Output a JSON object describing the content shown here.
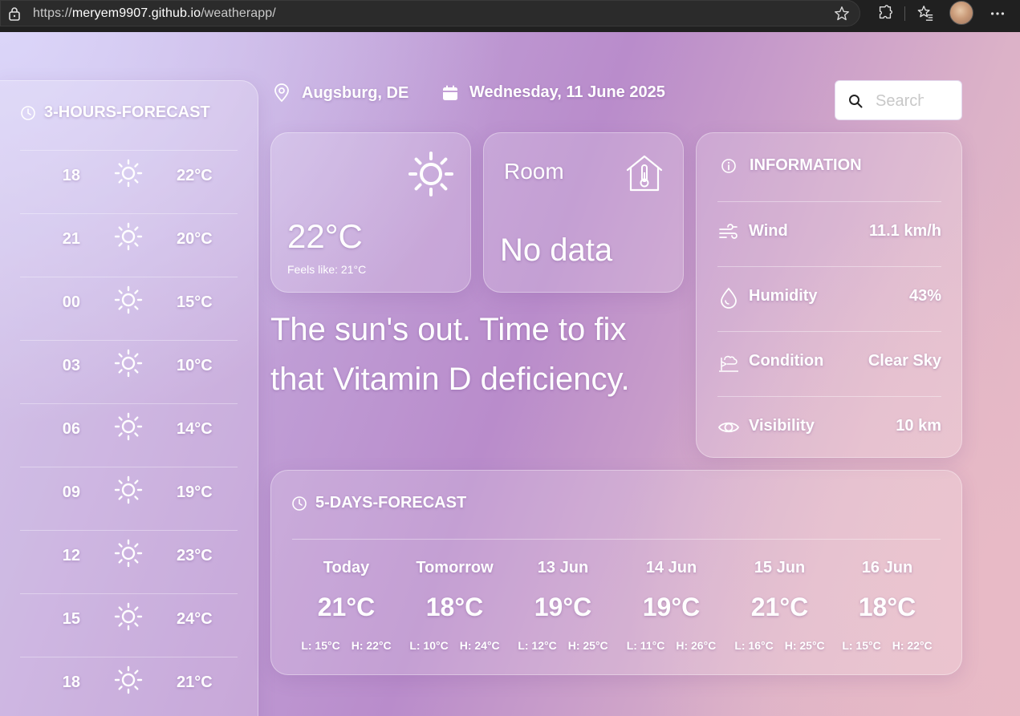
{
  "browser": {
    "url_prefix": "https://",
    "url_host": "meryem9907.github.io",
    "url_path": "/weatherapp/"
  },
  "header": {
    "location": "Augsburg, DE",
    "date": "Wednesday, 11 June 2025",
    "search_placeholder": "Search"
  },
  "hourly": {
    "title": "3-HOURS-FORECAST",
    "rows": [
      {
        "hour": "18",
        "temp": "22°C",
        "icon": "sun-icon"
      },
      {
        "hour": "21",
        "temp": "20°C",
        "icon": "sun-icon"
      },
      {
        "hour": "00",
        "temp": "15°C",
        "icon": "sun-icon"
      },
      {
        "hour": "03",
        "temp": "10°C",
        "icon": "sun-icon"
      },
      {
        "hour": "06",
        "temp": "14°C",
        "icon": "sun-icon"
      },
      {
        "hour": "09",
        "temp": "19°C",
        "icon": "sun-icon"
      },
      {
        "hour": "12",
        "temp": "23°C",
        "icon": "sun-icon"
      },
      {
        "hour": "15",
        "temp": "24°C",
        "icon": "sun-icon"
      },
      {
        "hour": "18",
        "temp": "21°C",
        "icon": "sun-icon"
      }
    ]
  },
  "current": {
    "temp": "22°C",
    "feels_like": "Feels like: 21°C",
    "icon": "sun-icon"
  },
  "room": {
    "title": "Room",
    "value": "No data",
    "icon": "house-thermometer-icon"
  },
  "quote": "The sun's out. Time to fix that Vitamin D deficiency.",
  "information": {
    "title": "INFORMATION",
    "rows": [
      {
        "label": "Wind",
        "value": "11.1 km/h",
        "icon": "wind-icon"
      },
      {
        "label": "Humidity",
        "value": "43%",
        "icon": "droplet-icon"
      },
      {
        "label": "Condition",
        "value": "Clear Sky",
        "icon": "weather-vane-icon"
      },
      {
        "label": "Visibility",
        "value": "10 km",
        "icon": "eye-icon"
      }
    ]
  },
  "five_day": {
    "title": "5-DAYS-FORECAST",
    "days": [
      {
        "name": "Today",
        "temp": "21°C",
        "low": "L: 15°C",
        "high": "H: 22°C"
      },
      {
        "name": "Tomorrow",
        "temp": "18°C",
        "low": "L: 10°C",
        "high": "H: 24°C"
      },
      {
        "name": "13 Jun",
        "temp": "19°C",
        "low": "L: 12°C",
        "high": "H: 25°C"
      },
      {
        "name": "14 Jun",
        "temp": "19°C",
        "low": "L: 11°C",
        "high": "H: 26°C"
      },
      {
        "name": "15 Jun",
        "temp": "21°C",
        "low": "L: 16°C",
        "high": "H: 25°C"
      },
      {
        "name": "16 Jun",
        "temp": "18°C",
        "low": "L: 15°C",
        "high": "H: 22°C"
      }
    ]
  }
}
